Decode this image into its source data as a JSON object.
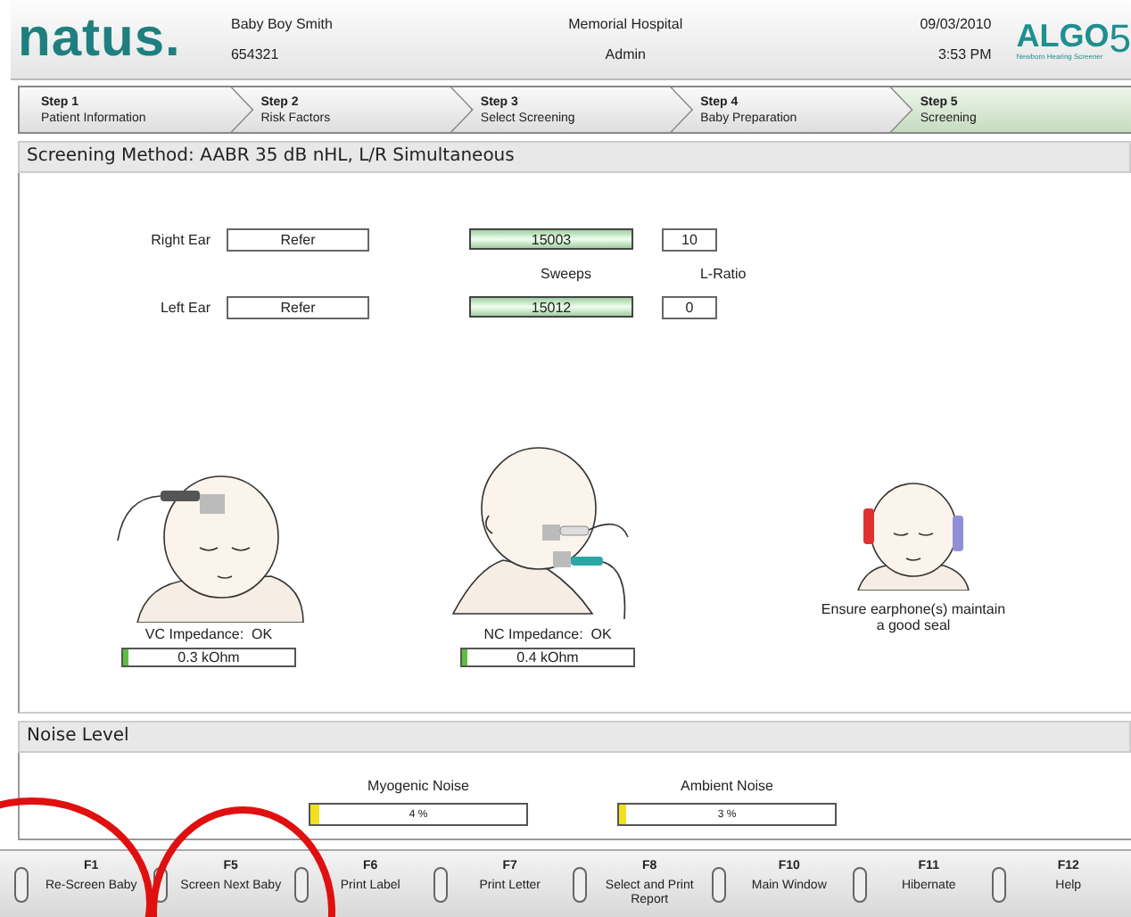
{
  "header": {
    "logo": "natus.",
    "patient_name": "Baby Boy Smith",
    "patient_id": "654321",
    "hospital": "Memorial Hospital",
    "user": "Admin",
    "date": "09/03/2010",
    "time": "3:53 PM",
    "product_logo": "ALGO",
    "product_number": "5",
    "product_tagline": "Newborn Hearing Screener"
  },
  "steps": [
    {
      "number": "Step 1",
      "label": "Patient Information",
      "selected": false
    },
    {
      "number": "Step 2",
      "label": "Risk Factors",
      "selected": false
    },
    {
      "number": "Step 3",
      "label": "Select Screening",
      "selected": false
    },
    {
      "number": "Step 4",
      "label": "Baby Preparation",
      "selected": false
    },
    {
      "number": "Step 5",
      "label": "Screening",
      "selected": true
    }
  ],
  "screening_method": "Screening Method: AABR 35 dB nHL, L/R Simultaneous",
  "ears": [
    {
      "label": "Right Ear",
      "result": "Refer",
      "sweeps": "15003",
      "l_ratio": "10"
    },
    {
      "label": "Left Ear",
      "result": "Refer",
      "sweeps": "15012",
      "l_ratio": "0"
    }
  ],
  "sweeps_label": "Sweeps",
  "l_ratio_label": "L-Ratio",
  "impedance": [
    {
      "label": "VC Impedance:  OK",
      "reading": "0.3 kOhm",
      "level": 0.03
    },
    {
      "label": "NC Impedance:  OK",
      "reading": "0.4 kOhm",
      "level": 0.03
    }
  ],
  "earphone_note": "Ensure earphone(s) maintain a good seal",
  "noise": {
    "title": "Noise Level",
    "meters": [
      {
        "label": "Myogenic Noise",
        "reading": "4 %",
        "level": 0.04
      },
      {
        "label": "Ambient Noise",
        "reading": "3 %",
        "level": 0.03
      }
    ]
  },
  "function_keys": [
    {
      "key": "F1",
      "label": "Re-Screen Baby"
    },
    {
      "key": "F5",
      "label": "Screen Next Baby"
    },
    {
      "key": "F6",
      "label": "Print Label"
    },
    {
      "key": "F7",
      "label": "Print Letter"
    },
    {
      "key": "F8",
      "label": "Select and Print Report"
    },
    {
      "key": "F10",
      "label": "Main Window"
    },
    {
      "key": "F11",
      "label": "Hibernate"
    },
    {
      "key": "F12",
      "label": "Help"
    }
  ]
}
